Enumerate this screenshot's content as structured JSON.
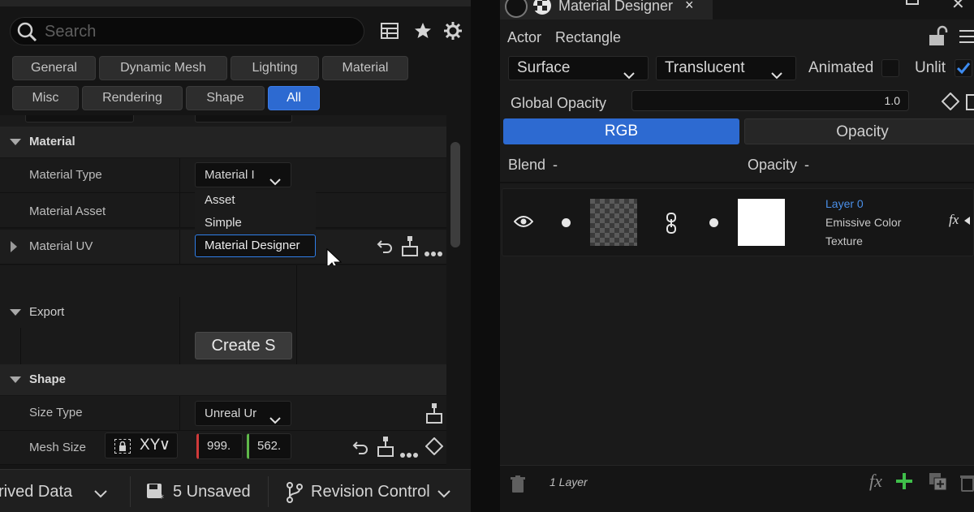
{
  "left": {
    "search": {
      "placeholder": "Search"
    },
    "toolbar_icons": [
      "table-icon",
      "star-icon",
      "gear-icon"
    ],
    "filters": [
      {
        "label": "General",
        "active": false
      },
      {
        "label": "Dynamic Mesh",
        "active": false
      },
      {
        "label": "Lighting",
        "active": false
      },
      {
        "label": "Material",
        "active": false
      },
      {
        "label": "Misc",
        "active": false
      },
      {
        "label": "Rendering",
        "active": false
      },
      {
        "label": "Shape",
        "active": false
      },
      {
        "label": "All",
        "active": true
      }
    ],
    "material_section": {
      "title": "Material",
      "material_type": {
        "label": "Material Type",
        "value": "Material I"
      },
      "material_asset": {
        "label": "Material Asset"
      },
      "material_uv": {
        "label": "Material UV"
      },
      "dropdown_options": [
        "Asset",
        "Simple",
        "Material Designer"
      ],
      "selected_option": "Material Designer"
    },
    "export_section": {
      "title": "Export",
      "create_button": "Create S"
    },
    "shape_section": {
      "title": "Shape",
      "size_type": {
        "label": "Size Type",
        "value": "Unreal Ur"
      },
      "mesh_size": {
        "label": "Mesh Size",
        "lock_label": "XY",
        "x_value": "999.",
        "y_value": "562."
      }
    },
    "statusbar": {
      "derived_data": "rived Data",
      "unsaved": "5 Unsaved",
      "revision_control": "Revision Control"
    }
  },
  "right": {
    "tab": {
      "title": "Material Designer",
      "close": "×"
    },
    "actor_label": "Actor",
    "actor_value": "Rectangle",
    "surface": "Surface",
    "blend_mode": "Translucent",
    "animated_label": "Animated",
    "unlit_label": "Unlit",
    "unlit_checked": true,
    "global_opacity": {
      "label": "Global Opacity",
      "value": "1.0"
    },
    "channels": [
      {
        "label": "RGB",
        "active": true
      },
      {
        "label": "Opacity",
        "active": false
      }
    ],
    "blend_header": {
      "label": "Blend",
      "value": "-"
    },
    "opacity_header": {
      "label": "Opacity",
      "value": "-"
    },
    "layer": {
      "name": "Layer 0",
      "line1": "Emissive Color",
      "line2": "Texture",
      "fx": "fx"
    },
    "layer_count": "1 Layer",
    "footer_fx": "fx",
    "accent": "#2d6ad1",
    "add_color": "#3fbf4a"
  }
}
